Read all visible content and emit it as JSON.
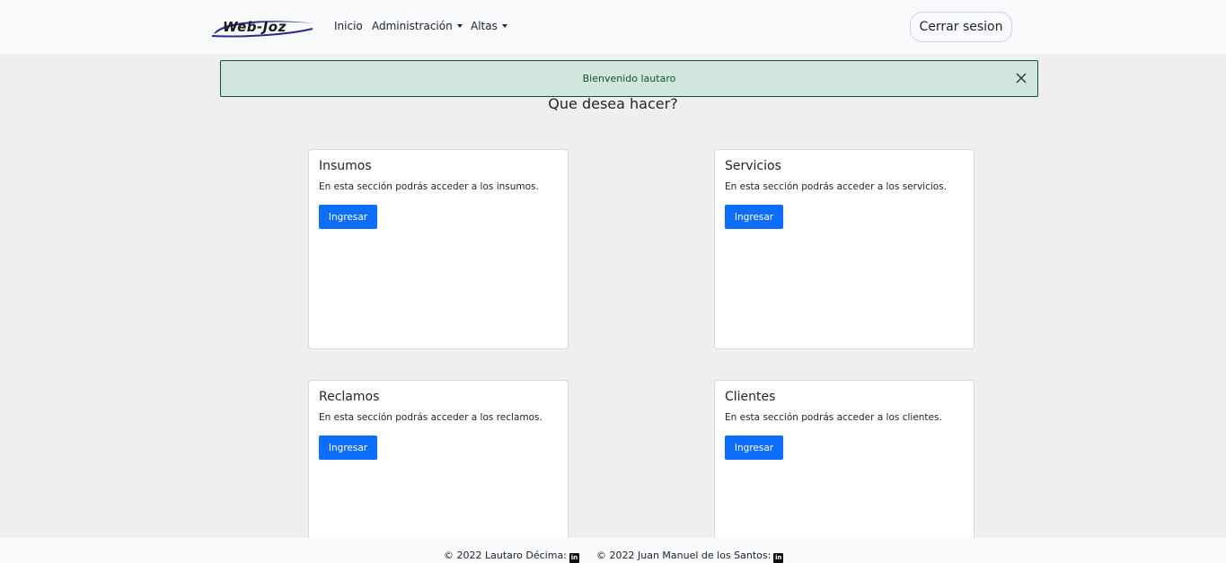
{
  "navbar": {
    "logo_text": "Web-Joz",
    "links": [
      "Inicio",
      "Administración",
      "Altas"
    ],
    "logout_label": "Cerrar sesion"
  },
  "alert": {
    "message": "Bienvenido lautaro"
  },
  "heading": "Que desea hacer?",
  "cards": [
    {
      "title": "Insumos",
      "text": "En esta sección podrás acceder a los insumos.",
      "button": "Ingresar"
    },
    {
      "title": "Servicios",
      "text": "En esta sección podrás acceder a los servicios.",
      "button": "Ingresar"
    },
    {
      "title": "Reclamos",
      "text": "En esta sección podrás acceder a los reclamos.",
      "button": "Ingresar"
    },
    {
      "title": "Clientes",
      "text": "En esta sección podrás acceder a los clientes.",
      "button": "Ingresar"
    }
  ],
  "footer": {
    "credit_1": "© 2022 Lautaro Décima:",
    "credit_2": "© 2022 Juan Manuel de los Santos:",
    "icon_label": "in"
  },
  "colors": {
    "primary": "#0d6efd",
    "alert_bg": "#d1e7dd",
    "alert_text": "#0f5132",
    "logo_swoosh": "#2e2a8f"
  },
  "icons": [
    "close-icon",
    "caret-down-icon",
    "linkedin-icon"
  ]
}
